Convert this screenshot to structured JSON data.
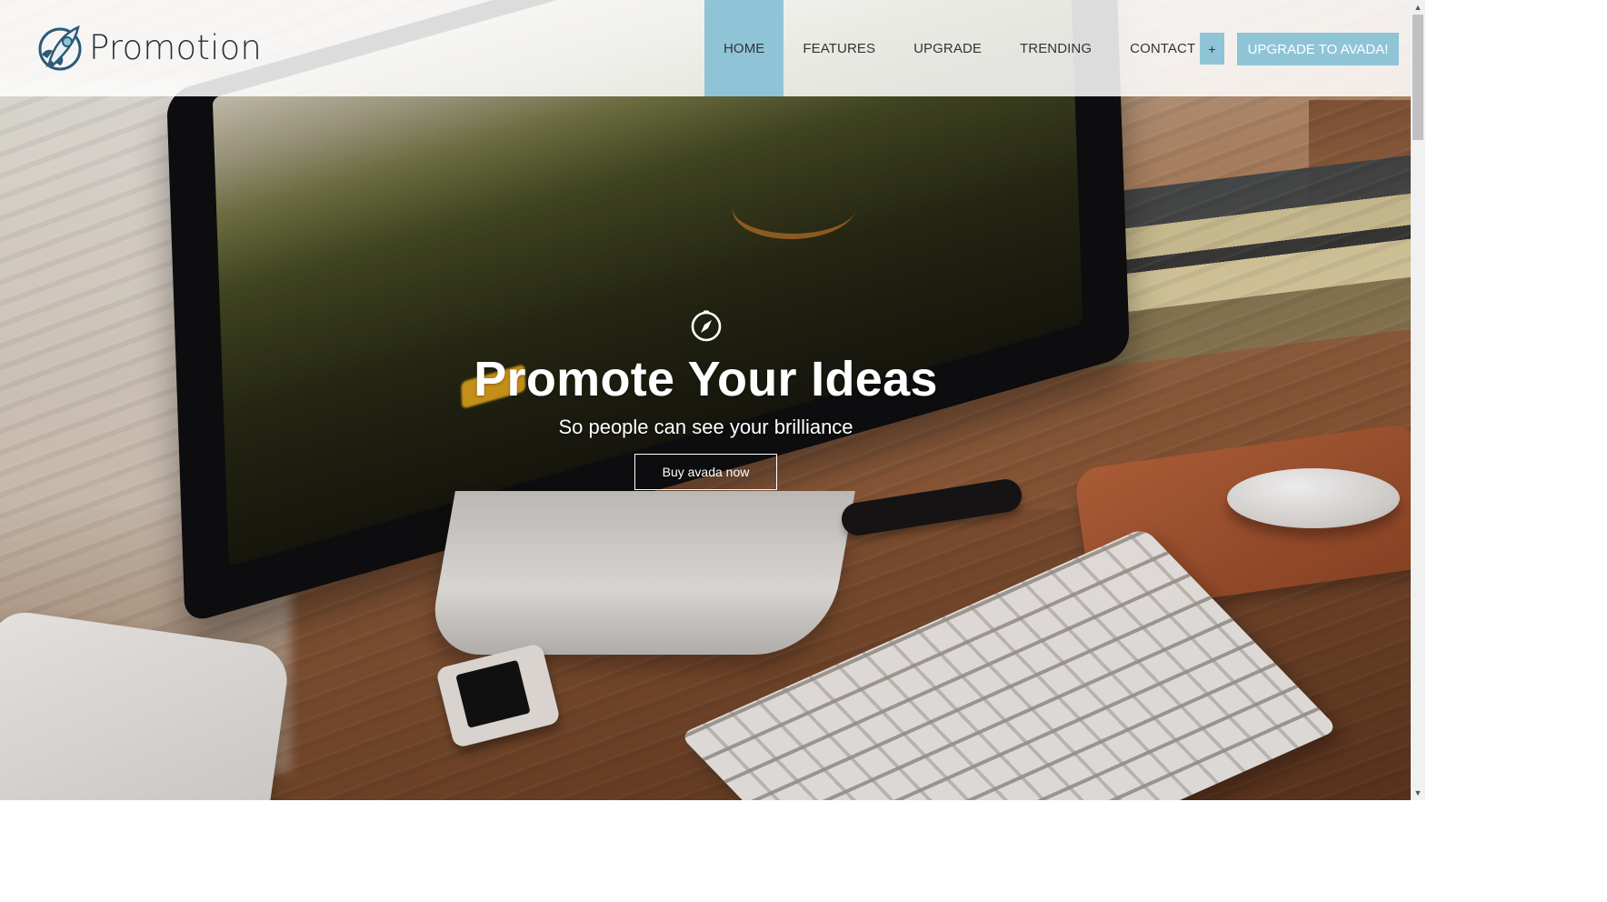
{
  "brand": {
    "name": "Promotion",
    "accent_color": "#8fc4d7",
    "logo_icon": "rocket-icon"
  },
  "nav": {
    "items": [
      {
        "label": "HOME",
        "active": true
      },
      {
        "label": "FEATURES",
        "active": false
      },
      {
        "label": "UPGRADE",
        "active": false
      },
      {
        "label": "TRENDING",
        "active": false
      },
      {
        "label": "CONTACT",
        "active": false
      }
    ],
    "plus_label": "+",
    "cta_label": "UPGRADE TO AVADA!"
  },
  "hero": {
    "icon": "compass-icon",
    "title": "Promote Your Ideas",
    "subtitle": "So people can see your brilliance",
    "button_label": "Buy avada now"
  },
  "scrollbar": {
    "up_icon": "scroll-up-arrow-icon",
    "down_icon": "scroll-down-arrow-icon",
    "up_glyph": "▲",
    "down_glyph": "▼"
  }
}
